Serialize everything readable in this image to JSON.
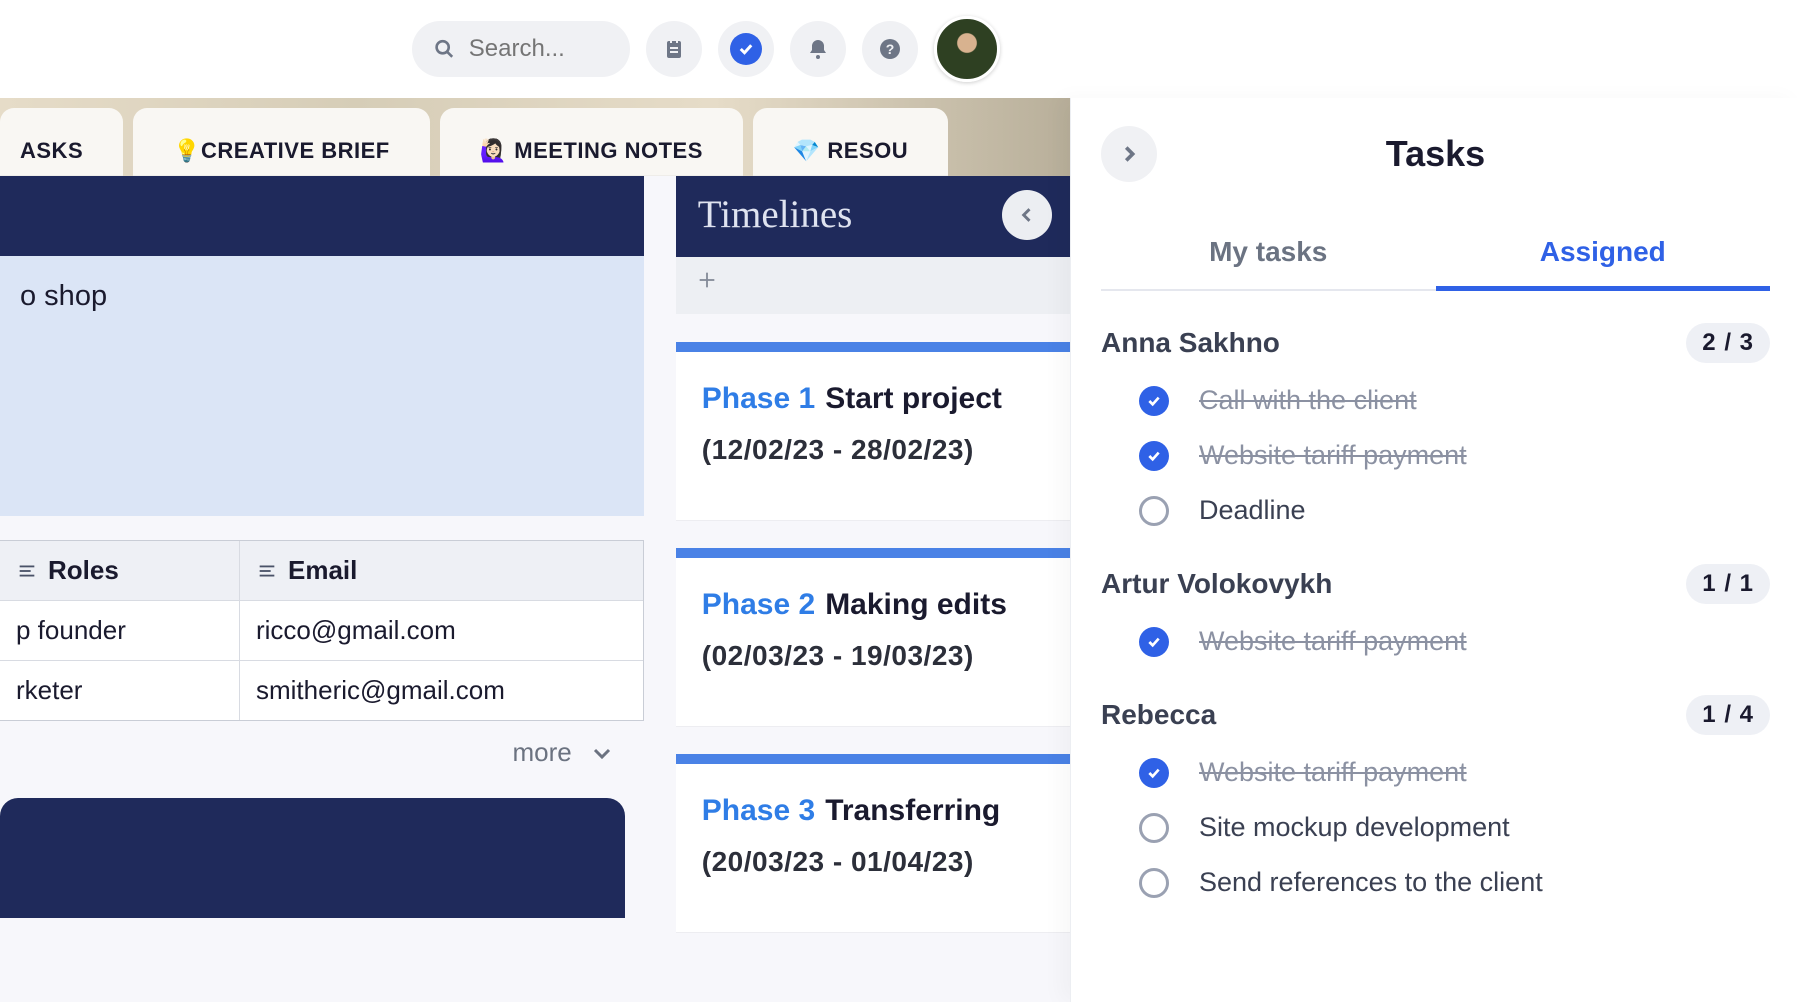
{
  "header": {
    "search_placeholder": "Search..."
  },
  "tabs": [
    "ASKS",
    "💡CREATIVE BRIEF",
    "🙋🏻‍♀️ MEETING NOTES",
    "💎 RESOU"
  ],
  "left": {
    "shop_text": "o shop",
    "table": {
      "roles_header": "Roles",
      "email_header": "Email",
      "rows": [
        {
          "role": "p founder",
          "email": "ricco@gmail.com"
        },
        {
          "role": "rketer",
          "email": "smitheric@gmail.com"
        }
      ],
      "more_label": "more"
    }
  },
  "timelines": {
    "title": "Timelines",
    "phases": [
      {
        "label": "Phase 1",
        "title": "Start project",
        "range": "(12/02/23 - 28/02/23)"
      },
      {
        "label": "Phase 2",
        "title": "Making edits",
        "range": "(02/03/23 - 19/03/23)"
      },
      {
        "label": "Phase 3",
        "title": "Transferring",
        "range": "(20/03/23 - 01/04/23)"
      }
    ]
  },
  "panel": {
    "title": "Tasks",
    "tabs": {
      "my": "My tasks",
      "assigned": "Assigned"
    },
    "assignees": [
      {
        "name": "Anna Sakhno",
        "count": "2 / 3",
        "tasks": [
          {
            "label": "Call with the client",
            "done": true
          },
          {
            "label": "Website tariff payment",
            "done": true
          },
          {
            "label": "Deadline",
            "done": false
          }
        ]
      },
      {
        "name": "Artur Volokovykh",
        "count": "1 / 1",
        "tasks": [
          {
            "label": "Website tariff payment",
            "done": true
          }
        ]
      },
      {
        "name": "Rebecca",
        "count": "1 / 4",
        "tasks": [
          {
            "label": "Website tariff payment",
            "done": true
          },
          {
            "label": "Site mockup development",
            "done": false
          },
          {
            "label": "Send references to the client",
            "done": false
          }
        ]
      }
    ]
  }
}
